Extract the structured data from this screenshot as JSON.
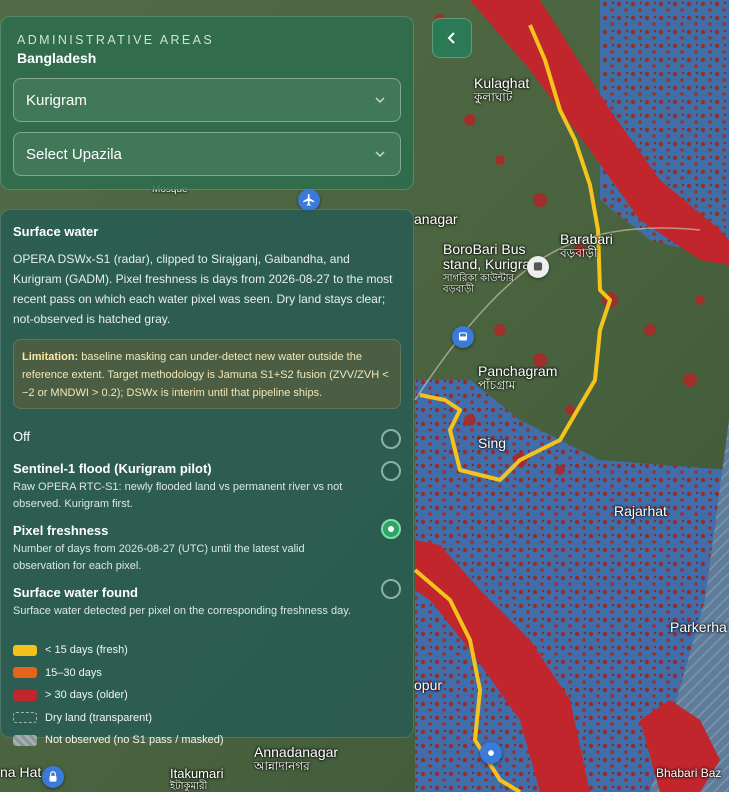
{
  "admin": {
    "heading": "ADMINISTRATIVE AREAS",
    "country": "Bangladesh",
    "district_value": "Kurigram",
    "upazila_value": "Select Upazila"
  },
  "layer": {
    "title": "Surface water",
    "description": "OPERA DSWx-S1 (radar), clipped to Sirajganj, Gaibandha, and Kurigram (GADM). Pixel freshness is days from 2026-08-27 to the most recent pass on which each water pixel was seen. Dry land stays clear; not-observed is hatched gray.",
    "limitation_label": "Limitation:",
    "limitation_text": " baseline masking can under-detect new water outside the reference extent. Target methodology is Jamuna S1+S2 fusion (ZVV/ZVH < −2 or MNDWI > 0.2); DSWx is interim until that pipeline ships.",
    "options": [
      {
        "title": "Off",
        "subtitle": "",
        "checked": false
      },
      {
        "title": "Sentinel-1 flood (Kurigram pilot)",
        "subtitle": "Raw OPERA RTC-S1: newly flooded land vs permanent river vs not observed. Kurigram first.",
        "checked": false
      },
      {
        "title": "Pixel freshness",
        "subtitle": "Number of days from 2026-08-27 (UTC) until the latest valid observation for each pixel.",
        "checked": true
      },
      {
        "title": "Surface water found",
        "subtitle": "Surface water detected per pixel on the corresponding freshness day.",
        "checked": false
      }
    ],
    "legend": [
      {
        "label": "< 15 days (fresh)",
        "color": "#f2c21b"
      },
      {
        "label": "15–30 days",
        "color": "#e8631a"
      },
      {
        "label": "> 30 days (older)",
        "color": "#c0262b"
      },
      {
        "label": "Dry land (transparent)",
        "color": "transparent"
      },
      {
        "label": "Not observed (no S1 pass / masked)",
        "color": "#8b9696"
      }
    ]
  },
  "map_labels": {
    "kulaghat": "Kulaghat",
    "kulaghat_bn": "কুলাঘাট",
    "nanagar": "anagar",
    "borobari": "BoroBari Bus",
    "borobari2": "stand, Kurigram",
    "borobari_bn": "সাগরিকা কাউন্টার",
    "borobari_bn2": "বড়বাড়ী",
    "barabari": "Barabari",
    "barabari_bn": "বড়বাড়ী",
    "panchagram": "Panchagram",
    "panchagram_bn": "পাঁচগ্রাম",
    "singer": "Sing",
    "rajarhat": "Rajarhat",
    "annadanagar": "Annadanagar",
    "annadanagar_bn": "আন্নাদানগর",
    "itakumari": "Itakumari",
    "itakumari_bn": "ইটাকুমারী",
    "hahat": "na Hat",
    "kurigram_pur": "opur",
    "parkerha": "Parkerha",
    "mosque": "Mosque",
    "shubari": "Bhabari Baz"
  },
  "colors": {
    "fresh": "#f2c21b",
    "mid": "#e8631a",
    "old": "#c0262b",
    "boundary": "#f5c41c"
  }
}
